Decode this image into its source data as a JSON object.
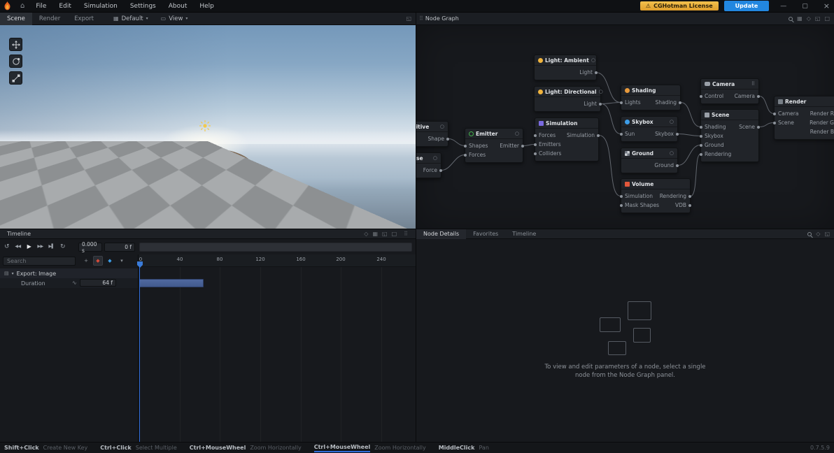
{
  "menubar": {
    "menus": [
      "File",
      "Edit",
      "Simulation",
      "Settings",
      "About",
      "Help"
    ],
    "license_badge": "CGHotman License",
    "update_button": "Update"
  },
  "viewport_bar": {
    "tabs": [
      "Scene",
      "Render",
      "Export"
    ],
    "active_tab": "Scene",
    "layout_select": "Default",
    "view_select": "View"
  },
  "node_graph": {
    "title": "Node Graph",
    "nodes": [
      {
        "title": "Light: Ambient",
        "inputs": [],
        "outputs": [
          "Light"
        ]
      },
      {
        "title": "Light: Directional",
        "inputs": [],
        "outputs": [
          "Light"
        ]
      },
      {
        "title": "Primitive",
        "inputs": [],
        "outputs": [
          "Shape"
        ]
      },
      {
        "title": "Emitter",
        "inputs": [
          "Shapes",
          "Forces"
        ],
        "outputs": [
          "Emitter"
        ]
      },
      {
        "title": "Noise",
        "inputs": [],
        "outputs": [
          "Force"
        ]
      },
      {
        "title": "Simulation",
        "inputs": [
          "Forces",
          "Emitters",
          "Colliders"
        ],
        "outputs": [
          "Simulation"
        ]
      },
      {
        "title": "Shading",
        "inputs": [
          "Lights"
        ],
        "outputs": [
          "Shading"
        ]
      },
      {
        "title": "Skybox",
        "inputs": [
          "Sun"
        ],
        "outputs": [
          "Skybox"
        ]
      },
      {
        "title": "Ground",
        "inputs": [],
        "outputs": [
          "Ground"
        ]
      },
      {
        "title": "Volume",
        "inputs": [
          "Simulation",
          "Mask Shapes"
        ],
        "outputs": [
          "Rendering",
          "VDB"
        ]
      },
      {
        "title": "Camera",
        "inputs": [
          "Control"
        ],
        "outputs": [
          "Camera"
        ]
      },
      {
        "title": "Scene",
        "inputs": [
          "Shading",
          "Skybox",
          "Ground",
          "Rendering"
        ],
        "outputs": [
          "Scene"
        ]
      },
      {
        "title": "Render",
        "inputs": [
          "Camera",
          "Scene"
        ],
        "outputs": [
          "Render R",
          "Render G",
          "Render B"
        ]
      }
    ]
  },
  "timeline": {
    "title": "Timeline",
    "time_field": "0.000 s",
    "frame_field": "0 f",
    "search_placeholder": "Search",
    "ruler_ticks": [
      "0",
      "40",
      "80",
      "120",
      "160",
      "200",
      "240"
    ],
    "track_group": "Export: Image",
    "track_row": {
      "label": "Duration",
      "value": "64 f"
    }
  },
  "node_details": {
    "tabs": [
      "Node Details",
      "Favorites",
      "Timeline"
    ],
    "active_tab": "Node Details",
    "empty_line1": "To view and edit parameters of a node, select a single",
    "empty_line2": "node from the Node Graph panel."
  },
  "statusbar": {
    "hints": [
      {
        "key": "Shift+Click",
        "action": "Create New Key"
      },
      {
        "key": "Ctrl+Click",
        "action": "Select Multiple"
      },
      {
        "key": "Ctrl+MouseWheel",
        "action": "Zoom Horizontally"
      },
      {
        "key": "Ctrl+MouseWheel",
        "action": "Zoom Horizontally"
      },
      {
        "key": "MiddleClick",
        "action": "Pan"
      }
    ],
    "version": "0.7.5.9"
  },
  "colors": {
    "accent_blue": "#2287e0",
    "badge_yellow": "#e9b23c",
    "playhead_blue": "#2f6bd8",
    "wire_gray": "#6b7078",
    "duration_bar": "#47629c"
  },
  "icons": {
    "home": "⌂",
    "warning": "⚠",
    "minimize": "—",
    "maximize": "▢",
    "close": "×",
    "chevron": "▾",
    "grid": "▦",
    "monitor": "▭",
    "expand": "◱",
    "box": "□",
    "diamond": "◆",
    "diamond_outline": "◇",
    "handle": "⠿",
    "reset": "↺",
    "rew": "◀◀",
    "play": "▶",
    "ffwd": "▶▶",
    "toend": "▶▌",
    "loop": "↻",
    "wave": "∿",
    "tree": "▤",
    "power": "○",
    "plus": "+"
  }
}
